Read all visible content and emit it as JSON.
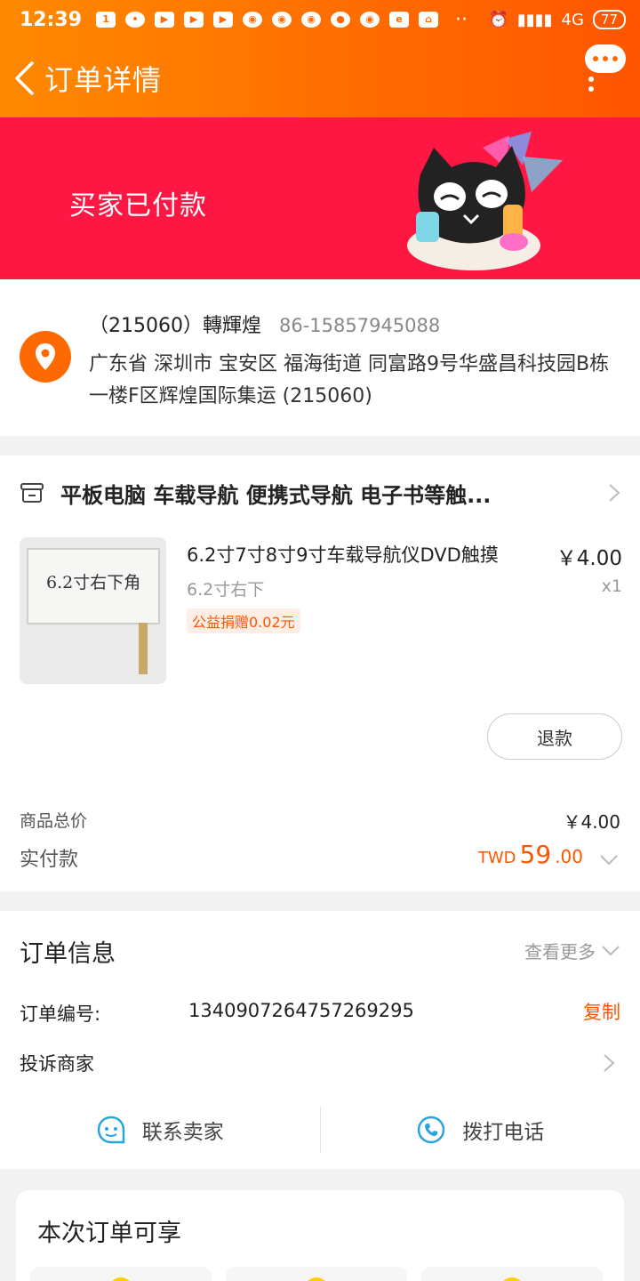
{
  "status_bar": {
    "time": "12:39",
    "network": "4G",
    "battery": "77"
  },
  "header": {
    "title": "订单详情"
  },
  "banner": {
    "status": "买家已付款"
  },
  "address": {
    "name": "（215060）轉輝煌",
    "phone": "86-15857945088",
    "detail": "广东省 深圳市 宝安区 福海街道 同富路9号华盛昌科技园B栋一楼F区辉煌国际集运 (215060)"
  },
  "order": {
    "shop_name": "平板电脑 车载导航 便携式导航 电子书等触...",
    "item": {
      "title": "6.2寸7寸8寸9寸车载导航仪DVD触摸",
      "price": "￥4.00",
      "sku": "6.2寸右下",
      "qty": "x1",
      "charity": "公益捐赠0.02元",
      "image_label": "6.2寸右下角"
    },
    "refund_label": "退款",
    "total_label": "商品总价",
    "total_value": "￥4.00",
    "paid_label": "实付款",
    "paid_currency": "TWD",
    "paid_integer": "59",
    "paid_decimal": ".00"
  },
  "info": {
    "title": "订单信息",
    "see_more": "查看更多",
    "order_no_label": "订单编号:",
    "order_no": "1340907264757269295",
    "copy_label": "复制",
    "complain_label": "投诉商家",
    "contact_seller": "联系卖家",
    "call_phone": "拨打电话"
  },
  "benefits": {
    "title": "本次订单可享"
  },
  "colors": {
    "accent": "#ff5500",
    "banner": "#ff1744",
    "header_gradient_start": "#ff8a00"
  }
}
